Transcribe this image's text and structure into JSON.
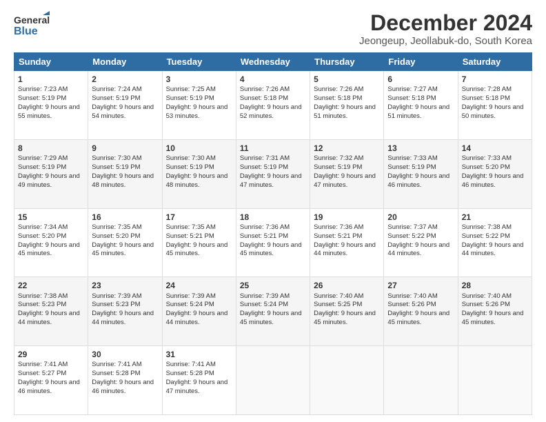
{
  "header": {
    "logo_line1": "General",
    "logo_line2": "Blue",
    "month_title": "December 2024",
    "location": "Jeongeup, Jeollabuk-do, South Korea"
  },
  "days_of_week": [
    "Sunday",
    "Monday",
    "Tuesday",
    "Wednesday",
    "Thursday",
    "Friday",
    "Saturday"
  ],
  "weeks": [
    [
      {
        "day": "1",
        "sunrise": "Sunrise: 7:23 AM",
        "sunset": "Sunset: 5:19 PM",
        "daylight": "Daylight: 9 hours and 55 minutes."
      },
      {
        "day": "2",
        "sunrise": "Sunrise: 7:24 AM",
        "sunset": "Sunset: 5:19 PM",
        "daylight": "Daylight: 9 hours and 54 minutes."
      },
      {
        "day": "3",
        "sunrise": "Sunrise: 7:25 AM",
        "sunset": "Sunset: 5:19 PM",
        "daylight": "Daylight: 9 hours and 53 minutes."
      },
      {
        "day": "4",
        "sunrise": "Sunrise: 7:26 AM",
        "sunset": "Sunset: 5:18 PM",
        "daylight": "Daylight: 9 hours and 52 minutes."
      },
      {
        "day": "5",
        "sunrise": "Sunrise: 7:26 AM",
        "sunset": "Sunset: 5:18 PM",
        "daylight": "Daylight: 9 hours and 51 minutes."
      },
      {
        "day": "6",
        "sunrise": "Sunrise: 7:27 AM",
        "sunset": "Sunset: 5:18 PM",
        "daylight": "Daylight: 9 hours and 51 minutes."
      },
      {
        "day": "7",
        "sunrise": "Sunrise: 7:28 AM",
        "sunset": "Sunset: 5:18 PM",
        "daylight": "Daylight: 9 hours and 50 minutes."
      }
    ],
    [
      {
        "day": "8",
        "sunrise": "Sunrise: 7:29 AM",
        "sunset": "Sunset: 5:19 PM",
        "daylight": "Daylight: 9 hours and 49 minutes."
      },
      {
        "day": "9",
        "sunrise": "Sunrise: 7:30 AM",
        "sunset": "Sunset: 5:19 PM",
        "daylight": "Daylight: 9 hours and 48 minutes."
      },
      {
        "day": "10",
        "sunrise": "Sunrise: 7:30 AM",
        "sunset": "Sunset: 5:19 PM",
        "daylight": "Daylight: 9 hours and 48 minutes."
      },
      {
        "day": "11",
        "sunrise": "Sunrise: 7:31 AM",
        "sunset": "Sunset: 5:19 PM",
        "daylight": "Daylight: 9 hours and 47 minutes."
      },
      {
        "day": "12",
        "sunrise": "Sunrise: 7:32 AM",
        "sunset": "Sunset: 5:19 PM",
        "daylight": "Daylight: 9 hours and 47 minutes."
      },
      {
        "day": "13",
        "sunrise": "Sunrise: 7:33 AM",
        "sunset": "Sunset: 5:19 PM",
        "daylight": "Daylight: 9 hours and 46 minutes."
      },
      {
        "day": "14",
        "sunrise": "Sunrise: 7:33 AM",
        "sunset": "Sunset: 5:20 PM",
        "daylight": "Daylight: 9 hours and 46 minutes."
      }
    ],
    [
      {
        "day": "15",
        "sunrise": "Sunrise: 7:34 AM",
        "sunset": "Sunset: 5:20 PM",
        "daylight": "Daylight: 9 hours and 45 minutes."
      },
      {
        "day": "16",
        "sunrise": "Sunrise: 7:35 AM",
        "sunset": "Sunset: 5:20 PM",
        "daylight": "Daylight: 9 hours and 45 minutes."
      },
      {
        "day": "17",
        "sunrise": "Sunrise: 7:35 AM",
        "sunset": "Sunset: 5:21 PM",
        "daylight": "Daylight: 9 hours and 45 minutes."
      },
      {
        "day": "18",
        "sunrise": "Sunrise: 7:36 AM",
        "sunset": "Sunset: 5:21 PM",
        "daylight": "Daylight: 9 hours and 45 minutes."
      },
      {
        "day": "19",
        "sunrise": "Sunrise: 7:36 AM",
        "sunset": "Sunset: 5:21 PM",
        "daylight": "Daylight: 9 hours and 44 minutes."
      },
      {
        "day": "20",
        "sunrise": "Sunrise: 7:37 AM",
        "sunset": "Sunset: 5:22 PM",
        "daylight": "Daylight: 9 hours and 44 minutes."
      },
      {
        "day": "21",
        "sunrise": "Sunrise: 7:38 AM",
        "sunset": "Sunset: 5:22 PM",
        "daylight": "Daylight: 9 hours and 44 minutes."
      }
    ],
    [
      {
        "day": "22",
        "sunrise": "Sunrise: 7:38 AM",
        "sunset": "Sunset: 5:23 PM",
        "daylight": "Daylight: 9 hours and 44 minutes."
      },
      {
        "day": "23",
        "sunrise": "Sunrise: 7:39 AM",
        "sunset": "Sunset: 5:23 PM",
        "daylight": "Daylight: 9 hours and 44 minutes."
      },
      {
        "day": "24",
        "sunrise": "Sunrise: 7:39 AM",
        "sunset": "Sunset: 5:24 PM",
        "daylight": "Daylight: 9 hours and 44 minutes."
      },
      {
        "day": "25",
        "sunrise": "Sunrise: 7:39 AM",
        "sunset": "Sunset: 5:24 PM",
        "daylight": "Daylight: 9 hours and 45 minutes."
      },
      {
        "day": "26",
        "sunrise": "Sunrise: 7:40 AM",
        "sunset": "Sunset: 5:25 PM",
        "daylight": "Daylight: 9 hours and 45 minutes."
      },
      {
        "day": "27",
        "sunrise": "Sunrise: 7:40 AM",
        "sunset": "Sunset: 5:26 PM",
        "daylight": "Daylight: 9 hours and 45 minutes."
      },
      {
        "day": "28",
        "sunrise": "Sunrise: 7:40 AM",
        "sunset": "Sunset: 5:26 PM",
        "daylight": "Daylight: 9 hours and 45 minutes."
      }
    ],
    [
      {
        "day": "29",
        "sunrise": "Sunrise: 7:41 AM",
        "sunset": "Sunset: 5:27 PM",
        "daylight": "Daylight: 9 hours and 46 minutes."
      },
      {
        "day": "30",
        "sunrise": "Sunrise: 7:41 AM",
        "sunset": "Sunset: 5:28 PM",
        "daylight": "Daylight: 9 hours and 46 minutes."
      },
      {
        "day": "31",
        "sunrise": "Sunrise: 7:41 AM",
        "sunset": "Sunset: 5:28 PM",
        "daylight": "Daylight: 9 hours and 47 minutes."
      },
      null,
      null,
      null,
      null
    ]
  ]
}
